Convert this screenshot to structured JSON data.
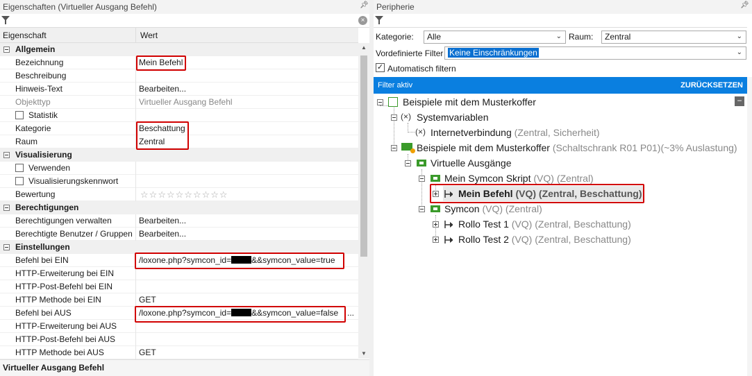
{
  "left": {
    "title": "Eigenschaften (Virtueller Ausgang Befehl)",
    "col_property": "Eigenschaft",
    "col_value": "Wert",
    "rows": [
      {
        "type": "cat",
        "name": "Allgemein"
      },
      {
        "type": "prop",
        "name": "Bezeichnung",
        "value": "Mein Befehl"
      },
      {
        "type": "prop",
        "name": "Beschreibung",
        "value": ""
      },
      {
        "type": "prop",
        "name": "Hinweis-Text",
        "value": "Bearbeiten..."
      },
      {
        "type": "prop",
        "name": "Objekttyp",
        "value": "Virtueller Ausgang Befehl"
      },
      {
        "type": "check",
        "name": "Statistik",
        "value": ""
      },
      {
        "type": "prop",
        "name": "Kategorie",
        "value": "Beschattung"
      },
      {
        "type": "prop",
        "name": "Raum",
        "value": "Zentral"
      },
      {
        "type": "cat",
        "name": "Visualisierung"
      },
      {
        "type": "check",
        "name": "Verwenden",
        "value": ""
      },
      {
        "type": "check",
        "name": "Visualisierungskennwort",
        "value": ""
      },
      {
        "type": "prop",
        "name": "Bewertung",
        "value": ""
      },
      {
        "type": "cat",
        "name": "Berechtigungen"
      },
      {
        "type": "prop",
        "name": "Berechtigungen verwalten",
        "value": "Bearbeiten..."
      },
      {
        "type": "prop",
        "name": "Berechtigte Benutzer / Gruppen",
        "value": "Bearbeiten..."
      },
      {
        "type": "cat",
        "name": "Einstellungen"
      },
      {
        "type": "prop",
        "name": "Befehl bei EIN",
        "value": ""
      },
      {
        "type": "prop",
        "name": "HTTP-Erweiterung bei EIN",
        "value": ""
      },
      {
        "type": "prop",
        "name": "HTTP-Post-Befehl bei EIN",
        "value": ""
      },
      {
        "type": "prop",
        "name": "HTTP Methode bei EIN",
        "value": "GET"
      },
      {
        "type": "prop",
        "name": "Befehl bei AUS",
        "value": ""
      },
      {
        "type": "prop",
        "name": "HTTP-Erweiterung bei AUS",
        "value": ""
      },
      {
        "type": "prop",
        "name": "HTTP-Post-Befehl bei AUS",
        "value": ""
      },
      {
        "type": "prop",
        "name": "HTTP Methode bei AUS",
        "value": "GET"
      }
    ],
    "cmd_on_prefix": "/loxone.php?symcon_id=",
    "cmd_on_suffix": "&&symcon_value=true",
    "cmd_off_prefix": "/loxone.php?symcon_id=",
    "cmd_off_suffix": "&&symcon_value=false",
    "ellipsis": "...",
    "footer": "Virtueller Ausgang Befehl",
    "rating_stars": 10
  },
  "right": {
    "title": "Peripherie",
    "kategorie_label": "Kategorie:",
    "kategorie_value": "Alle",
    "raum_label": "Raum:",
    "raum_value": "Zentral",
    "vordef_label": "Vordefinierte Filter",
    "vordef_value": "Keine Einschränkungen",
    "auto_filter_label": "Automatisch filtern",
    "filter_active": "Filter aktiv",
    "reset": "ZURÜCKSETZEN",
    "tree": {
      "n1": "Beispiele mit dem Musterkoffer",
      "n2": "Systemvariablen",
      "n3": "Internetverbindung",
      "n3s": "(Zentral, Sicherheit)",
      "n4": "Beispiele mit dem Musterkoffer",
      "n4s": "(Schaltschrank R01 P01)(~3% Auslastung)",
      "n5": "Virtuelle Ausgänge",
      "n6": "Mein Symcon Skript",
      "n6s": "(VQ) (Zentral)",
      "n7": "Mein Befehl",
      "n7s": "(VQ) (Zentral, Beschattung)",
      "n8": "Symcon",
      "n8s": "(VQ) (Zentral)",
      "n9": "Rollo Test 1",
      "n9s": "(VQ) (Zentral, Beschattung)",
      "n10": "Rollo Test 2",
      "n10s": "(VQ) (Zentral, Beschattung)"
    }
  }
}
